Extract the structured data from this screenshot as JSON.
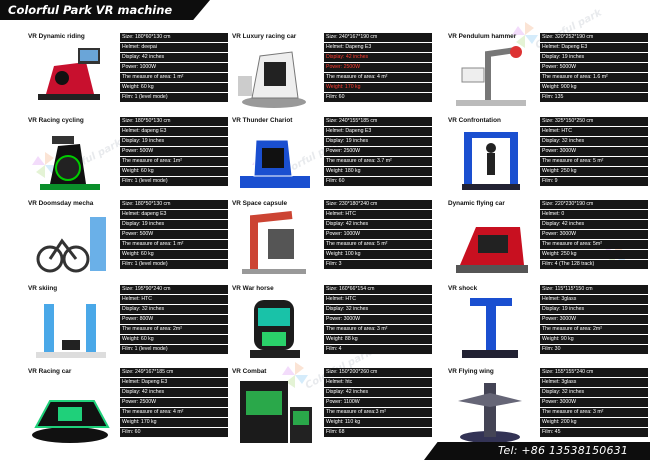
{
  "header": {
    "title": "Colorful Park VR machine"
  },
  "footer": {
    "tel": "Tel: +86 13538150631"
  },
  "watermark": {
    "brand": "Colorful park"
  },
  "colors": {
    "header_bg": "#0d0d0d",
    "spec_bg": "#161616",
    "spec_text": "#ffffff",
    "highlight": "#ff3b2f"
  },
  "products": [
    {
      "name": "VR Dynamic riding",
      "icon": "motorbike-simulator-icon",
      "specs": [
        {
          "text": "Size: 180*60*130 cm"
        },
        {
          "text": "Helmet: deepai"
        },
        {
          "text": "Display: 42 inches"
        },
        {
          "text": "Power: 1000W"
        },
        {
          "text": "The measure of area: 1 m²"
        },
        {
          "text": "Weight: 60 kg"
        },
        {
          "text": "Film: 1    (level mode)"
        }
      ]
    },
    {
      "name": "VR Luxury racing car",
      "icon": "racing-seat-icon",
      "specs": [
        {
          "text": "Size: 240*167*190 cm"
        },
        {
          "text": "Helmet: Dapeng E3"
        },
        {
          "text": "Display: 42 inches",
          "hl": true
        },
        {
          "text": "Power: 2500W",
          "hl": true
        },
        {
          "text": "The measure of area: 4 m²"
        },
        {
          "text": "Weight: 170 kg",
          "hl": true
        },
        {
          "text": "Film: 60"
        }
      ]
    },
    {
      "name": "VR Pendulum hammer",
      "icon": "pendulum-arm-icon",
      "specs": [
        {
          "text": "Size: 320*252*190 cm"
        },
        {
          "text": "Helmet: Dapeng E3"
        },
        {
          "text": "Display: 19 inches"
        },
        {
          "text": "Power: 5000W"
        },
        {
          "text": "The measure of area: 1.6 m²"
        },
        {
          "text": "Weight: 900 kg"
        },
        {
          "text": "Film: 135"
        }
      ]
    },
    {
      "name": "VR Racing cycling",
      "icon": "exercise-bike-icon",
      "specs": [
        {
          "text": "Size: 180*50*130 cm"
        },
        {
          "text": "Helmet: dapeng E3"
        },
        {
          "text": "Display: 19 inches"
        },
        {
          "text": "Power: 500W"
        },
        {
          "text": "The measure of area: 1m²"
        },
        {
          "text": "Weight: 60 kg"
        },
        {
          "text": "Film: 1    (level mode)"
        }
      ]
    },
    {
      "name": "VR Thunder Chariot",
      "icon": "chariot-seat-icon",
      "specs": [
        {
          "text": "Size: 240*155*185 cm"
        },
        {
          "text": "Helmet: Dapeng E3"
        },
        {
          "text": "Display: 19 inches"
        },
        {
          "text": "Power: 2500W"
        },
        {
          "text": "The measure of area: 3.7 m²"
        },
        {
          "text": "Weight: 180 kg"
        },
        {
          "text": "Film: 60"
        }
      ]
    },
    {
      "name": "VR Confrontation",
      "icon": "standing-platform-icon",
      "specs": [
        {
          "text": "Size: 325*150*250 cm"
        },
        {
          "text": "Helmet: HTC"
        },
        {
          "text": "Display: 32 inches"
        },
        {
          "text": "Power: 3000W"
        },
        {
          "text": "The measure of area: 5 m²"
        },
        {
          "text": "Weight: 250 kg"
        },
        {
          "text": "Film: 9"
        }
      ]
    },
    {
      "name": "VR Doomsday mecha",
      "icon": "bike-kiosk-icon",
      "specs": [
        {
          "text": "Size: 180*50*130 cm"
        },
        {
          "text": "Helmet: dapeng E3"
        },
        {
          "text": "Display: 19 inches"
        },
        {
          "text": "Power: 500W"
        },
        {
          "text": "The measure of area: 1 m²"
        },
        {
          "text": "Weight: 60 kg"
        },
        {
          "text": "Film: 1    (level mode)"
        }
      ]
    },
    {
      "name": "VR Space capsule",
      "icon": "space-capsule-icon",
      "specs": [
        {
          "text": "Size: 230*180*240 cm"
        },
        {
          "text": "Helmet: HTC"
        },
        {
          "text": "Display: 42 inches"
        },
        {
          "text": "Power: 1000W"
        },
        {
          "text": "The measure of area: 5 m²"
        },
        {
          "text": "Weight: 100 kg"
        },
        {
          "text": "Film: 3"
        }
      ]
    },
    {
      "name": "Dynamic flying car",
      "icon": "flying-car-icon",
      "specs": [
        {
          "text": "Size: 220*230*190 cm"
        },
        {
          "text": "Helmet: 0"
        },
        {
          "text": "Display: 42 inches"
        },
        {
          "text": "Power: 3000W"
        },
        {
          "text": "The measure of area: 5m²"
        },
        {
          "text": "Weight: 250 kg"
        },
        {
          "text": "Film: 4    (The 128 track)"
        }
      ]
    },
    {
      "name": "VR skiing",
      "icon": "ski-simulator-icon",
      "specs": [
        {
          "text": "Size: 195*90*240 cm"
        },
        {
          "text": "Helmet: HTC"
        },
        {
          "text": "Display: 32 inches"
        },
        {
          "text": "Power: 800W"
        },
        {
          "text": "The measure of area: 2m²"
        },
        {
          "text": "Weight: 60 kg"
        },
        {
          "text": "Film: 1    (level mode)"
        }
      ]
    },
    {
      "name": "VR War horse",
      "icon": "war-horse-icon",
      "specs": [
        {
          "text": "Size: 160*66*154 cm"
        },
        {
          "text": "Helmet: HTC"
        },
        {
          "text": "Display: 32 inches"
        },
        {
          "text": "Power: 3000W"
        },
        {
          "text": "The measure of area: 3 m²"
        },
        {
          "text": "Weight: 88 kg"
        },
        {
          "text": "Film: 4"
        }
      ]
    },
    {
      "name": "VR shock",
      "icon": "shock-platform-icon",
      "specs": [
        {
          "text": "Size: 115*115*150 cm"
        },
        {
          "text": "Helmet: 3glass"
        },
        {
          "text": "Display: 19 inches"
        },
        {
          "text": "Power: 3000W"
        },
        {
          "text": "The measure of area: 2m²"
        },
        {
          "text": "Weight: 90 kg"
        },
        {
          "text": "Film: 30"
        }
      ]
    },
    {
      "name": "VR Racing car",
      "icon": "racing-car-icon",
      "specs": [
        {
          "text": "Size: 249*167*185 cm"
        },
        {
          "text": "Helmet: Dapeng E3"
        },
        {
          "text": "Display: 42 inches"
        },
        {
          "text": "Power: 2500W"
        },
        {
          "text": "The measure of area: 4 m²"
        },
        {
          "text": "Weight: 170 kg"
        },
        {
          "text": "Film: 60"
        }
      ]
    },
    {
      "name": "VR Combat",
      "icon": "combat-booth-icon",
      "specs": [
        {
          "text": "Size: 150*200*260 cm"
        },
        {
          "text": "Helmet: htc"
        },
        {
          "text": "Display: 42 inches"
        },
        {
          "text": "Power: 1100W"
        },
        {
          "text": "The measure of area:3 m²"
        },
        {
          "text": "Weight: 110 kg"
        },
        {
          "text": "Film: 68"
        }
      ]
    },
    {
      "name": "VR Flying wing",
      "icon": "flying-wing-icon",
      "specs": [
        {
          "text": "Size: 155*155*240 cm"
        },
        {
          "text": "Helmet: 3glass"
        },
        {
          "text": "Display: 32 inches"
        },
        {
          "text": "Power: 3000W"
        },
        {
          "text": "The measure of area: 3 m²"
        },
        {
          "text": "Weight: 200 kg"
        },
        {
          "text": "Film: 45"
        }
      ]
    }
  ]
}
